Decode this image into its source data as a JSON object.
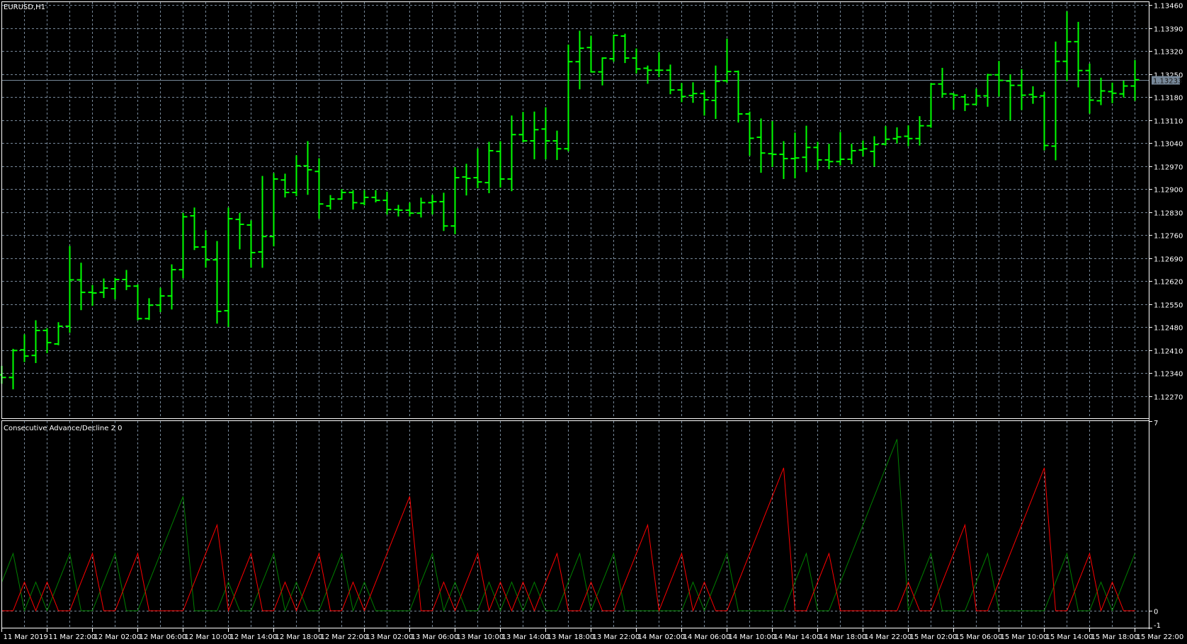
{
  "chart_data": [
    {
      "type": "bar",
      "subtype": "ohlc",
      "title": "EURUSD,H1",
      "bar_format": [
        "open",
        "high",
        "low",
        "close"
      ],
      "bars": [
        [
          1.12335,
          1.1236,
          1.1231,
          1.12327
        ],
        [
          1.12327,
          1.12412,
          1.12293,
          1.12409
        ],
        [
          1.12411,
          1.12456,
          1.12376,
          1.12392
        ],
        [
          1.12394,
          1.12499,
          1.12373,
          1.1247
        ],
        [
          1.1247,
          1.12475,
          1.12403,
          1.12433
        ],
        [
          1.12429,
          1.12493,
          1.12427,
          1.12483
        ],
        [
          1.12483,
          1.12725,
          1.12465,
          1.12624
        ],
        [
          1.12624,
          1.12674,
          1.12534,
          1.12586
        ],
        [
          1.12586,
          1.12606,
          1.12547,
          1.12584
        ],
        [
          1.12586,
          1.12626,
          1.12571,
          1.12599
        ],
        [
          1.12597,
          1.12628,
          1.12567,
          1.12625
        ],
        [
          1.12625,
          1.12652,
          1.12595,
          1.12605
        ],
        [
          1.12605,
          1.12608,
          1.12503,
          1.12506
        ],
        [
          1.12506,
          1.12566,
          1.12504,
          1.12547
        ],
        [
          1.12547,
          1.12598,
          1.12528,
          1.12575
        ],
        [
          1.12575,
          1.12669,
          1.12536,
          1.12655
        ],
        [
          1.12655,
          1.12826,
          1.12631,
          1.12816
        ],
        [
          1.12819,
          1.12842,
          1.12717,
          1.12724
        ],
        [
          1.12724,
          1.12773,
          1.12663,
          1.12685
        ],
        [
          1.12685,
          1.1274,
          1.12493,
          1.12528
        ],
        [
          1.1253,
          1.12842,
          1.12483,
          1.1281
        ],
        [
          1.12808,
          1.12826,
          1.12719,
          1.12793
        ],
        [
          1.12791,
          1.12803,
          1.12663,
          1.12707
        ],
        [
          1.12709,
          1.12938,
          1.12663,
          1.12756
        ],
        [
          1.12756,
          1.12947,
          1.12728,
          1.12931
        ],
        [
          1.12928,
          1.12945,
          1.12877,
          1.1289
        ],
        [
          1.1289,
          1.13001,
          1.12881,
          1.12971
        ],
        [
          1.12971,
          1.13044,
          1.12885,
          1.12959
        ],
        [
          1.12954,
          1.12992,
          1.12812,
          1.12855
        ],
        [
          1.12849,
          1.1288,
          1.1284,
          1.1287
        ],
        [
          1.1287,
          1.12898,
          1.1287,
          1.1289
        ],
        [
          1.1289,
          1.12895,
          1.1284,
          1.12859
        ],
        [
          1.12857,
          1.12895,
          1.12853,
          1.12875
        ],
        [
          1.12875,
          1.12895,
          1.12862,
          1.12866
        ],
        [
          1.12866,
          1.1289,
          1.12825,
          1.12838
        ],
        [
          1.12838,
          1.1285,
          1.12819,
          1.12836
        ],
        [
          1.12836,
          1.12857,
          1.12819,
          1.12827
        ],
        [
          1.12827,
          1.12872,
          1.12816,
          1.12859
        ],
        [
          1.12859,
          1.12881,
          1.12825,
          1.12862
        ],
        [
          1.12862,
          1.12887,
          1.12775,
          1.12788
        ],
        [
          1.12788,
          1.12965,
          1.12765,
          1.12935
        ],
        [
          1.12937,
          1.12975,
          1.12883,
          1.12933
        ],
        [
          1.12935,
          1.13022,
          1.12905,
          1.12922
        ],
        [
          1.1292,
          1.13042,
          1.1289,
          1.13017
        ],
        [
          1.13015,
          1.13044,
          1.12907,
          1.12931
        ],
        [
          1.12931,
          1.13122,
          1.12896,
          1.13066
        ],
        [
          1.13066,
          1.13133,
          1.13045,
          1.13047
        ],
        [
          1.13047,
          1.13134,
          1.12993,
          1.13081
        ],
        [
          1.13083,
          1.13147,
          1.12993,
          1.13047
        ],
        [
          1.13047,
          1.13076,
          1.12991,
          1.13023
        ],
        [
          1.13023,
          1.13338,
          1.13017,
          1.13288
        ],
        [
          1.13288,
          1.1338,
          1.13206,
          1.13329
        ],
        [
          1.13331,
          1.13365,
          1.13257,
          1.13257
        ],
        [
          1.13257,
          1.13299,
          1.13218,
          1.13299
        ],
        [
          1.13297,
          1.13368,
          1.1329,
          1.13368
        ],
        [
          1.13366,
          1.13371,
          1.13286,
          1.13299
        ],
        [
          1.13299,
          1.13326,
          1.13254,
          1.13266
        ],
        [
          1.13268,
          1.13274,
          1.13223,
          1.13262
        ],
        [
          1.13262,
          1.13315,
          1.13243,
          1.13262
        ],
        [
          1.13262,
          1.13277,
          1.13191,
          1.13202
        ],
        [
          1.13202,
          1.13221,
          1.13167,
          1.13182
        ],
        [
          1.13185,
          1.13223,
          1.13165,
          1.13191
        ],
        [
          1.13191,
          1.13199,
          1.13126,
          1.13172
        ],
        [
          1.1317,
          1.13274,
          1.13116,
          1.13228
        ],
        [
          1.1323,
          1.13356,
          1.13226,
          1.13258
        ],
        [
          1.13258,
          1.13259,
          1.13105,
          1.13129
        ],
        [
          1.13129,
          1.13134,
          1.13004,
          1.13055
        ],
        [
          1.13058,
          1.13113,
          1.12952,
          1.1301
        ],
        [
          1.13008,
          1.13105,
          1.1297,
          1.13006
        ],
        [
          1.13006,
          1.13044,
          1.12933,
          1.12993
        ],
        [
          1.12993,
          1.1307,
          1.12935,
          1.12995
        ],
        [
          1.12997,
          1.13091,
          1.12954,
          1.13027
        ],
        [
          1.13027,
          1.13042,
          1.12961,
          1.12989
        ],
        [
          1.12989,
          1.13036,
          1.12963,
          1.12984
        ],
        [
          1.12984,
          1.13072,
          1.12974,
          1.12991
        ],
        [
          1.12991,
          1.13036,
          1.12978,
          1.13017
        ],
        [
          1.13019,
          1.13046,
          1.13002,
          1.13023
        ],
        [
          1.13015,
          1.13059,
          1.12971,
          1.13036
        ],
        [
          1.13037,
          1.1309,
          1.13035,
          1.13052
        ],
        [
          1.13054,
          1.13086,
          1.13041,
          1.13059
        ],
        [
          1.13061,
          1.13092,
          1.13033,
          1.13054
        ],
        [
          1.13054,
          1.1312,
          1.13035,
          1.13093
        ],
        [
          1.13093,
          1.13221,
          1.13089,
          1.1322
        ],
        [
          1.1322,
          1.13267,
          1.13181,
          1.1319
        ],
        [
          1.1319,
          1.1319,
          1.13144,
          1.13186
        ],
        [
          1.13181,
          1.13187,
          1.1314,
          1.13158
        ],
        [
          1.13158,
          1.13204,
          1.13158,
          1.13184
        ],
        [
          1.13184,
          1.13249,
          1.13153,
          1.13248
        ],
        [
          1.13248,
          1.13288,
          1.13184,
          1.13231
        ],
        [
          1.13229,
          1.13247,
          1.13112,
          1.13216
        ],
        [
          1.13216,
          1.13263,
          1.13143,
          1.13186
        ],
        [
          1.13188,
          1.13211,
          1.13162,
          1.13181
        ],
        [
          1.13184,
          1.13194,
          1.1302,
          1.13033
        ],
        [
          1.13031,
          1.13347,
          1.1299,
          1.13289
        ],
        [
          1.13289,
          1.13439,
          1.13231,
          1.13349
        ],
        [
          1.13349,
          1.13407,
          1.13212,
          1.13261
        ],
        [
          1.13261,
          1.1328,
          1.13132,
          1.13171
        ],
        [
          1.13169,
          1.13237,
          1.13158,
          1.13199
        ],
        [
          1.13197,
          1.13222,
          1.13164,
          1.13192
        ],
        [
          1.1319,
          1.13228,
          1.13181,
          1.13214
        ],
        [
          1.13214,
          1.13291,
          1.13171,
          1.13233
        ]
      ],
      "ylim": [
        1.122,
        1.1347
      ],
      "price_ticks": [
        "1.13460",
        "1.13390",
        "1.13320",
        "1.13250",
        "1.13180",
        "1.13110",
        "1.13040",
        "1.12970",
        "1.12900",
        "1.12830",
        "1.12760",
        "1.12690",
        "1.12620",
        "1.12550",
        "1.12480",
        "1.12410",
        "1.12340",
        "1.12270"
      ],
      "current_price": "1.13233",
      "grid": true,
      "colors": {
        "bars": "#00ff00",
        "grid": "#778899",
        "price_line": "#778899",
        "background": "#000000",
        "text": "#ffffff"
      }
    },
    {
      "type": "line",
      "title": "Consecutive Advance/Decline 2 0",
      "ylim": [
        -1,
        7
      ],
      "y_ticks": [
        "7",
        "0",
        "-1"
      ],
      "zero_level": 0,
      "series": [
        {
          "name": "advance",
          "color": "#008000",
          "values": [
            1,
            2,
            0,
            1,
            0,
            1,
            2,
            0,
            0,
            1,
            2,
            0,
            0,
            1,
            2,
            3,
            4,
            0,
            0,
            0,
            1,
            0,
            0,
            1,
            2,
            0,
            1,
            0,
            0,
            1,
            2,
            0,
            1,
            0,
            0,
            0,
            0,
            1,
            2,
            0,
            1,
            0,
            0,
            1,
            0,
            1,
            0,
            1,
            0,
            0,
            1,
            2,
            0,
            1,
            2,
            0,
            0,
            0,
            0,
            0,
            0,
            1,
            0,
            1,
            2,
            0,
            0,
            0,
            0,
            0,
            1,
            2,
            0,
            0,
            1,
            2,
            3,
            4,
            5,
            6,
            0,
            1,
            2,
            0,
            0,
            0,
            1,
            2,
            0,
            0,
            0,
            0,
            0,
            1,
            2,
            0,
            0,
            1,
            0,
            1,
            2
          ]
        },
        {
          "name": "decline",
          "color": "#ff0000",
          "values": [
            0,
            0,
            1,
            0,
            1,
            0,
            0,
            1,
            2,
            0,
            0,
            1,
            2,
            0,
            0,
            0,
            0,
            1,
            2,
            3,
            0,
            1,
            2,
            0,
            0,
            1,
            0,
            1,
            2,
            0,
            0,
            1,
            0,
            1,
            2,
            3,
            4,
            0,
            0,
            1,
            0,
            1,
            2,
            0,
            1,
            0,
            1,
            0,
            1,
            2,
            0,
            0,
            1,
            0,
            0,
            1,
            2,
            3,
            0,
            1,
            2,
            0,
            1,
            0,
            0,
            1,
            2,
            3,
            4,
            5,
            0,
            0,
            1,
            2,
            0,
            0,
            0,
            0,
            0,
            0,
            1,
            0,
            0,
            1,
            2,
            3,
            0,
            0,
            1,
            2,
            3,
            4,
            5,
            0,
            0,
            1,
            2,
            0,
            1,
            0,
            0
          ]
        }
      ]
    }
  ],
  "time_axis": {
    "labels": [
      {
        "bar": 0,
        "text": "11 Mar 2019"
      },
      {
        "bar": 4,
        "text": "11 Mar 22:00"
      },
      {
        "bar": 8,
        "text": "12 Mar 02:00"
      },
      {
        "bar": 12,
        "text": "12 Mar 06:00"
      },
      {
        "bar": 16,
        "text": "12 Mar 10:00"
      },
      {
        "bar": 20,
        "text": "12 Mar 14:00"
      },
      {
        "bar": 24,
        "text": "12 Mar 18:00"
      },
      {
        "bar": 28,
        "text": "12 Mar 22:00"
      },
      {
        "bar": 32,
        "text": "13 Mar 02:00"
      },
      {
        "bar": 36,
        "text": "13 Mar 06:00"
      },
      {
        "bar": 40,
        "text": "13 Mar 10:00"
      },
      {
        "bar": 44,
        "text": "13 Mar 14:00"
      },
      {
        "bar": 48,
        "text": "13 Mar 18:00"
      },
      {
        "bar": 52,
        "text": "13 Mar 22:00"
      },
      {
        "bar": 56,
        "text": "14 Mar 02:00"
      },
      {
        "bar": 60,
        "text": "14 Mar 06:00"
      },
      {
        "bar": 64,
        "text": "14 Mar 10:00"
      },
      {
        "bar": 68,
        "text": "14 Mar 14:00"
      },
      {
        "bar": 72,
        "text": "14 Mar 18:00"
      },
      {
        "bar": 76,
        "text": "14 Mar 22:00"
      },
      {
        "bar": 80,
        "text": "15 Mar 02:00"
      },
      {
        "bar": 84,
        "text": "15 Mar 06:00"
      },
      {
        "bar": 88,
        "text": "15 Mar 10:00"
      },
      {
        "bar": 92,
        "text": "15 Mar 14:00"
      },
      {
        "bar": 96,
        "text": "15 Mar 18:00"
      },
      {
        "bar": 100,
        "text": "15 Mar 22:00"
      }
    ]
  }
}
